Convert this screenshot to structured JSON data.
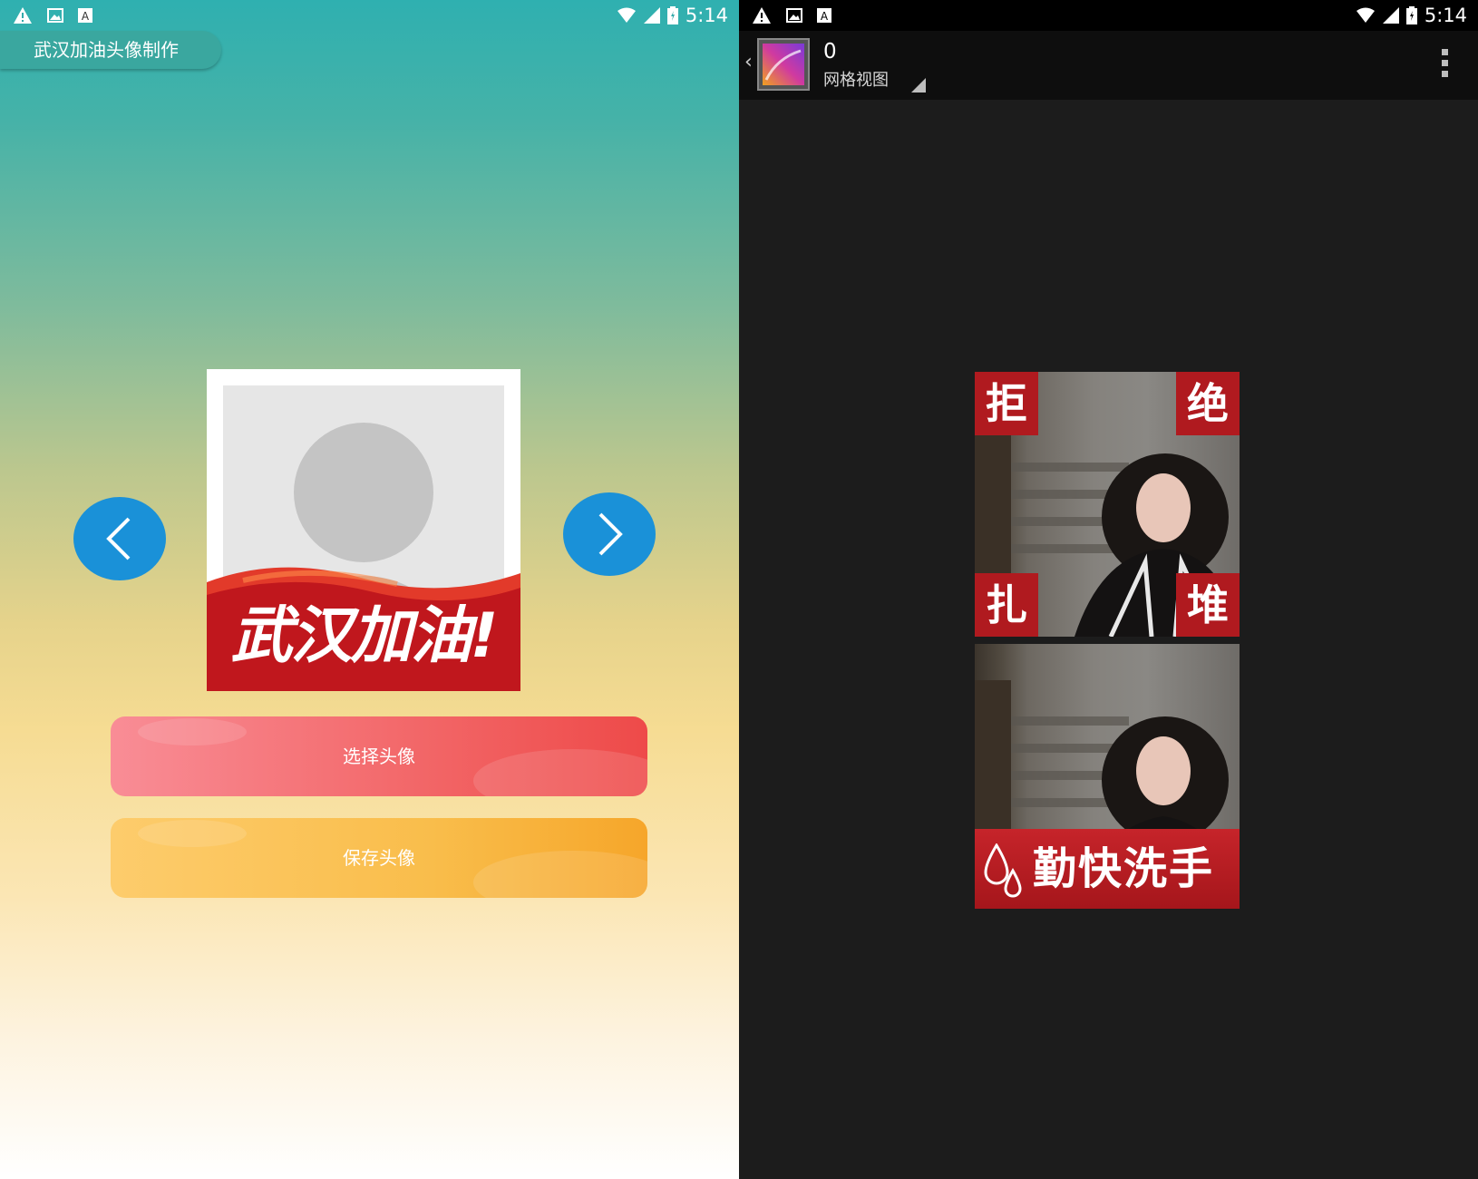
{
  "left_screen": {
    "status_bar": {
      "time": "5:14",
      "icons": [
        "warning-icon",
        "image-icon",
        "a-icon",
        "wifi-icon",
        "signal-icon",
        "battery-icon"
      ]
    },
    "app_title": "武汉加油头像制作",
    "avatar_banner_text": "武汉加油!",
    "buttons": {
      "select": "选择头像",
      "save": "保存头像"
    },
    "colors": {
      "nav_button": "#1a91d8",
      "select_button": "#f26566",
      "save_button": "#f8b43a"
    }
  },
  "right_screen": {
    "status_bar": {
      "time": "5:14",
      "icons": [
        "warning-icon",
        "image-icon",
        "a-icon",
        "wifi-icon",
        "signal-icon",
        "battery-icon"
      ]
    },
    "action_bar": {
      "count": "0",
      "view_mode": "网格视图"
    },
    "tile1": {
      "chars": [
        "拒",
        "绝",
        "扎",
        "堆"
      ]
    },
    "tile2": {
      "banner": "勤快洗手"
    }
  }
}
